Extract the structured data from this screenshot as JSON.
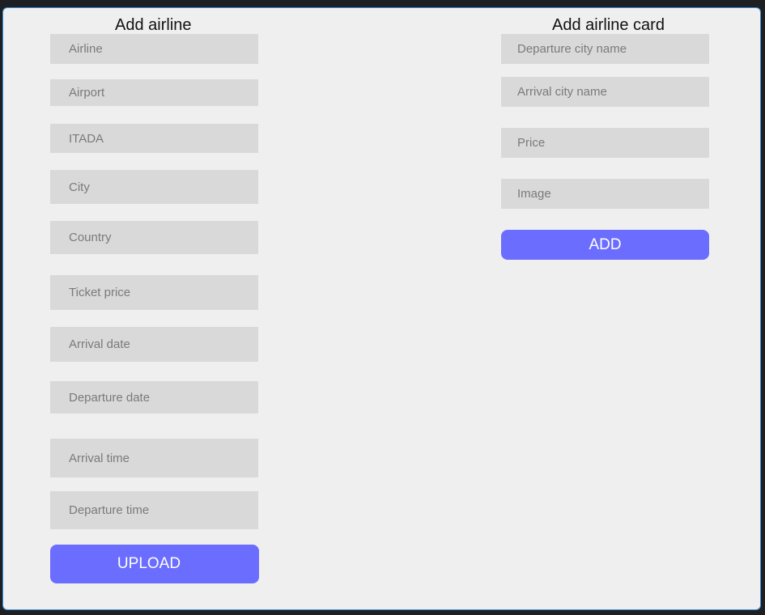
{
  "add_airline": {
    "title": "Add airline",
    "fields": {
      "airline": "Airline",
      "airport": "Airport",
      "itada": "ITADA",
      "city": "City",
      "country": "Country",
      "ticket_price": "Ticket price",
      "arrival_date": "Arrival date",
      "departure_date": "Departure date",
      "arrival_time": "Arrival time",
      "departure_time": "Departure time"
    },
    "upload_label": "UPLOAD"
  },
  "add_airline_card": {
    "title": "Add airline card",
    "fields": {
      "departure_city": "Departure city name",
      "arrival_city": "Arrival city name",
      "price": "Price",
      "image": "Image"
    },
    "add_label": "ADD"
  },
  "colors": {
    "button": "#6b6dff",
    "field": "#d9d9d9",
    "panel": "#efeff0"
  }
}
